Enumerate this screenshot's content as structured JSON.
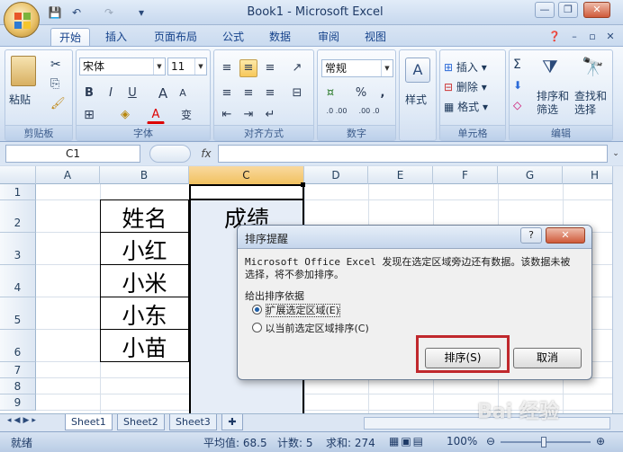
{
  "window": {
    "title": "Book1 - Microsoft Excel"
  },
  "qat": {
    "save": "💾",
    "undo": "↶",
    "redo": "↷",
    "customize": "▾"
  },
  "tabs": [
    "开始",
    "插入",
    "页面布局",
    "公式",
    "数据",
    "审阅",
    "视图"
  ],
  "ribbon": {
    "clipboard": {
      "label": "剪贴板",
      "paste": "粘贴"
    },
    "font": {
      "label": "字体",
      "name": "宋体",
      "size": "11",
      "bold": "B",
      "italic": "I",
      "underline": "U",
      "grow": "A",
      "shrink": "A",
      "color_letter": "A",
      "wen": "变"
    },
    "alignment": {
      "label": "对齐方式"
    },
    "number": {
      "label": "数字",
      "format": "常规",
      "percent": "%",
      "comma": ",",
      "inc_dec": ".0 .00",
      "dec_dec": ".00 .0"
    },
    "style": {
      "label": "样式"
    },
    "cells": {
      "label": "单元格",
      "insert": "插入",
      "delete": "删除",
      "format": "格式"
    },
    "editing": {
      "label": "编辑",
      "sum": "Σ",
      "sort_filter": "排序和\n筛选",
      "sort1": "排序和",
      "sort2": "筛选",
      "find1": "查找和",
      "find2": "选择"
    }
  },
  "formula_bar": {
    "namebox": "C1",
    "fx": "fx"
  },
  "grid": {
    "columns": [
      "A",
      "B",
      "C",
      "D",
      "E",
      "F",
      "G",
      "H"
    ],
    "rows": [
      "1",
      "2",
      "3",
      "4",
      "5",
      "6",
      "7",
      "8",
      "9"
    ],
    "names": [
      "姓名",
      "小红",
      "小米",
      "小东",
      "小苗"
    ],
    "score_header": "成绩"
  },
  "sheets": {
    "tabs": [
      "Sheet1",
      "Sheet2",
      "Sheet3"
    ]
  },
  "status": {
    "ready": "就绪",
    "average": "平均值: 68.5",
    "count": "计数: 5",
    "sum": "求和: 274",
    "zoom": "100%"
  },
  "dialog": {
    "title": "排序提醒",
    "message1": "Microsoft Office Excel 发现在选定区域旁边还有数据。该数据未被",
    "message2": "选择，将不参加排序。",
    "section": "给出排序依据",
    "option1": "扩展选定区域(E)",
    "option2": "以当前选定区域排序(C)",
    "sort_button": "排序(S)",
    "cancel_button": "取消"
  },
  "watermark": "Bai 经验"
}
